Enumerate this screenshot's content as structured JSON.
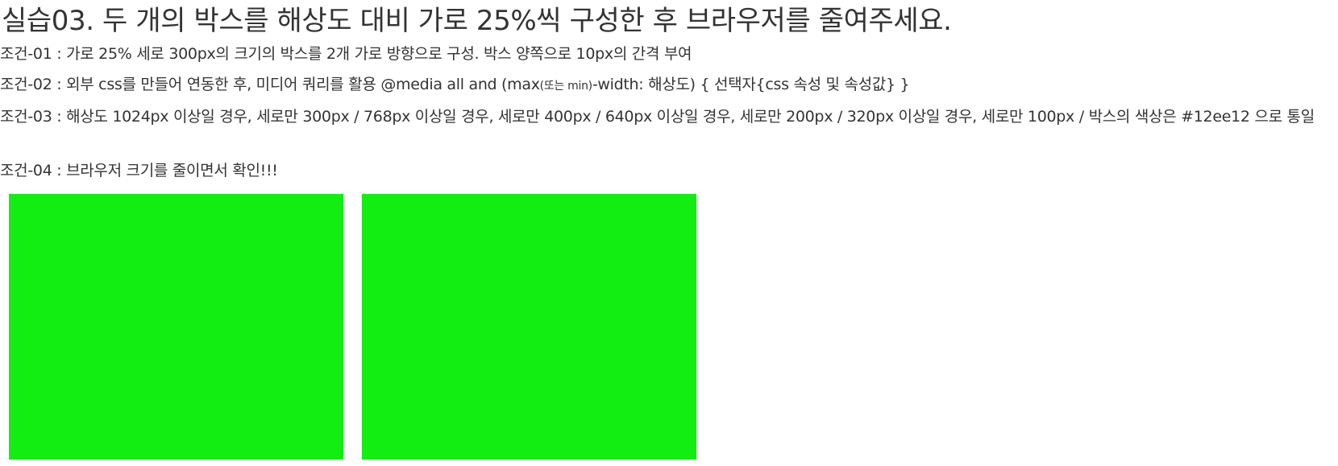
{
  "title": "실습03. 두 개의 박스를 해상도 대비 가로 25%씩 구성한 후 브라우저를 줄여주세요.",
  "conditions": {
    "c01": "조건-01 : 가로 25% 세로 300px의 크기의 박스를 2개 가로 방향으로 구성. 박스 양쪽으로 10px의 간격 부여",
    "c02_a": "조건-02 : 외부 css를 만들어 연동한 후, 미디어 쿼리를 활용 @media all and (max",
    "c02_small": "(또는 min)",
    "c02_b": "-width: 해상도) { 선택자{css 속성 및 속성값} }",
    "c03": "조건-03 : 해상도 1024px 이상일 경우, 세로만 300px / 768px 이상일 경우, 세로만 400px / 640px 이상일 경우, 세로만 200px / 320px 이상일 경우, 세로만 100px / 박스의 색상은 #12ee12 으로 통일",
    "c04": "조건-04 : 브라우저 크기를 줄이면서 확인!!!"
  },
  "boxes": {
    "color": "#12ee12",
    "count": 2
  }
}
